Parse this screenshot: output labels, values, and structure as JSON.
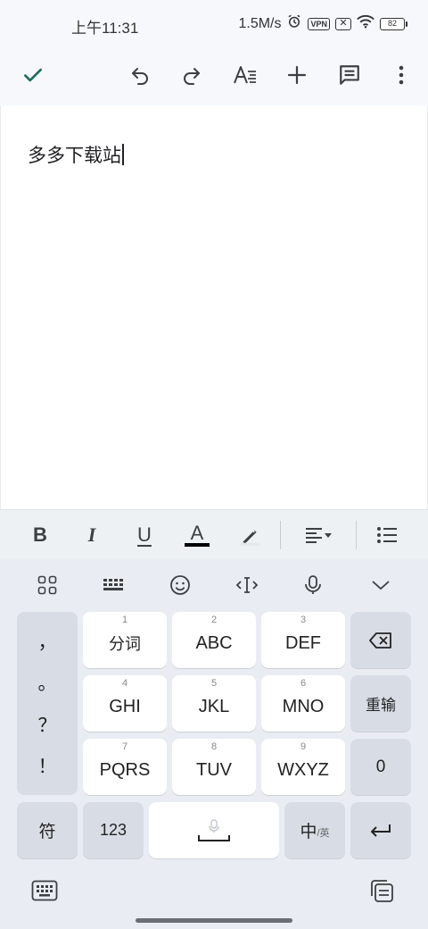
{
  "status_bar": {
    "time": "上午11:31",
    "network_speed": "1.5M/s",
    "vpn": "VPN",
    "battery": "82",
    "icons": [
      "alarm-icon",
      "vpn-icon",
      "sim-off-icon",
      "wifi-icon",
      "battery-icon"
    ]
  },
  "toolbar": {
    "icons": [
      "check-icon",
      "undo-icon",
      "redo-icon",
      "text-format-icon",
      "insert-icon",
      "comment-icon",
      "more-vert-icon"
    ]
  },
  "document": {
    "text": "多多下载站"
  },
  "format_bar": {
    "bold": "B",
    "italic": "I",
    "underline": "U",
    "text_color": "A",
    "text_color_value": "#000000",
    "icons": [
      "highlight-icon",
      "align-left-icon",
      "dropdown-arrow-icon",
      "bulleted-list-icon"
    ]
  },
  "keyboard": {
    "toolbar_icons": [
      "grid-menu-icon",
      "keyboard-layout-icon",
      "emoji-icon",
      "cursor-move-icon",
      "voice-icon",
      "collapse-icon"
    ],
    "punctuation": [
      "，",
      "。",
      "？",
      "！"
    ],
    "keys": [
      {
        "num": "1",
        "label": "分词"
      },
      {
        "num": "2",
        "label": "ABC"
      },
      {
        "num": "3",
        "label": "DEF"
      },
      {
        "num": "4",
        "label": "GHI"
      },
      {
        "num": "5",
        "label": "JKL"
      },
      {
        "num": "6",
        "label": "MNO"
      },
      {
        "num": "7",
        "label": "PQRS"
      },
      {
        "num": "8",
        "label": "TUV"
      },
      {
        "num": "9",
        "label": "WXYZ"
      }
    ],
    "side_keys": {
      "backspace_icon": "backspace-icon",
      "retype": "重输",
      "zero": "0"
    },
    "bottom_row": {
      "symbols": "符",
      "numbers": "123",
      "lang_main": "中",
      "lang_sub": "/英",
      "enter_icon": "enter-icon"
    },
    "bottom_icons": [
      "keyboard-switch-icon",
      "clipboard-icon"
    ]
  },
  "colors": {
    "accent": "#1e6b5c",
    "toolbar_bg": "#f6f8fc",
    "keyboard_bg": "#e9edf3"
  }
}
